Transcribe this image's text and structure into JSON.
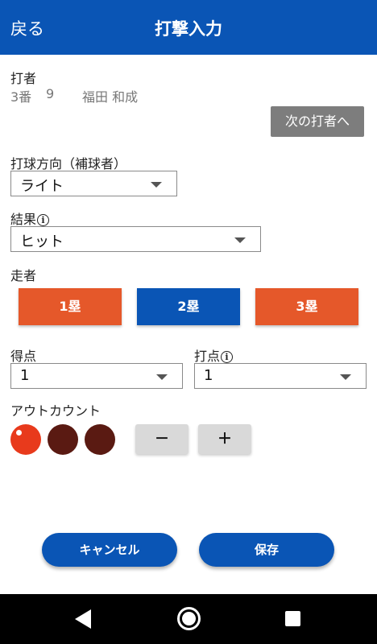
{
  "header": {
    "back_label": "戻る",
    "title": "打撃入力"
  },
  "batter": {
    "label": "打者",
    "order": "3番",
    "number": "9",
    "name": "福田 和成",
    "next_button": "次の打者へ"
  },
  "direction": {
    "label": "打球方向（補球者）",
    "value": "ライト"
  },
  "result": {
    "label": "結果",
    "value": "ヒット"
  },
  "runners": {
    "label": "走者",
    "bases": [
      {
        "label": "1塁",
        "color": "#e5582a"
      },
      {
        "label": "2塁",
        "color": "#0a55b5"
      },
      {
        "label": "3塁",
        "color": "#e5582a"
      }
    ]
  },
  "runs": {
    "label": "得点",
    "value": "1"
  },
  "rbi": {
    "label": "打点",
    "value": "1"
  },
  "outs": {
    "label": "アウトカウント",
    "count": 1,
    "max": 3,
    "active_color": "#e83a1c",
    "inactive_color": "#5a1a12",
    "minus_label": "－",
    "plus_label": "＋"
  },
  "actions": {
    "cancel_label": "キャンセル",
    "save_label": "保存"
  },
  "info_icon_glyph": "i",
  "system_nav": {
    "back_icon": "triangle-back-icon",
    "home_icon": "circle-home-icon",
    "recent_icon": "square-recent-icon"
  }
}
